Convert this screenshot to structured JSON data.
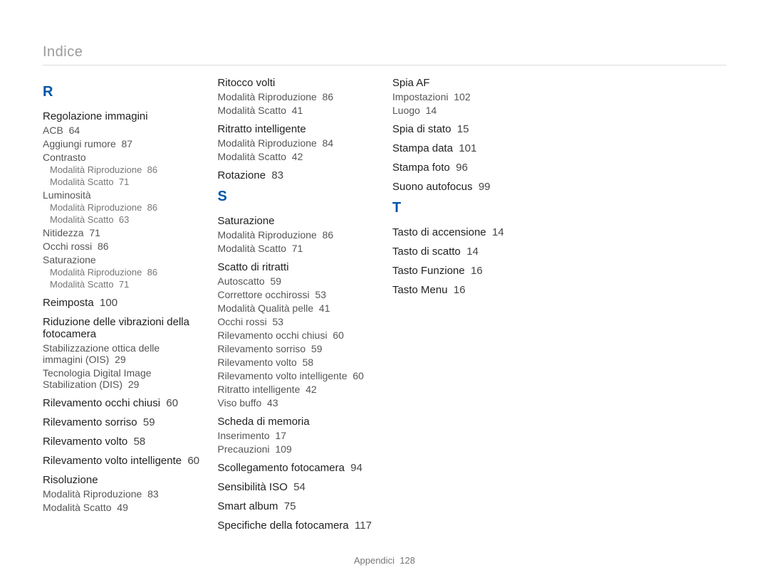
{
  "header": "Indice",
  "footer_label": "Appendici",
  "footer_page": "128",
  "sections": [
    {
      "letter": "R",
      "entries": [
        {
          "label": "Regolazione immagini",
          "subs": [
            {
              "label": "ACB",
              "page": "64"
            },
            {
              "label": "Aggiungi rumore",
              "page": "87"
            },
            {
              "label": "Contrasto",
              "subsubs": [
                {
                  "label": "Modalità Riproduzione",
                  "page": "86"
                },
                {
                  "label": "Modalità Scatto",
                  "page": "71"
                }
              ]
            },
            {
              "label": "Luminosità",
              "subsubs": [
                {
                  "label": "Modalità Riproduzione",
                  "page": "86"
                },
                {
                  "label": "Modalità Scatto",
                  "page": "63"
                }
              ]
            },
            {
              "label": "Nitidezza",
              "page": "71"
            },
            {
              "label": "Occhi rossi",
              "page": "86"
            },
            {
              "label": "Saturazione",
              "subsubs": [
                {
                  "label": "Modalità Riproduzione",
                  "page": "86"
                },
                {
                  "label": "Modalità Scatto",
                  "page": "71"
                }
              ]
            }
          ]
        },
        {
          "label": "Reimposta",
          "page": "100"
        },
        {
          "label": "Riduzione delle vibrazioni della fotocamera",
          "subs": [
            {
              "label": "Stabilizzazione ottica delle immagini (OIS)",
              "page": "29"
            },
            {
              "label": "Tecnologia Digital Image Stabilization (DIS)",
              "page": "29"
            }
          ]
        },
        {
          "label": "Rilevamento occhi chiusi",
          "page": "60"
        },
        {
          "label": "Rilevamento sorriso",
          "page": "59"
        },
        {
          "label": "Rilevamento volto",
          "page": "58"
        },
        {
          "label": "Rilevamento volto intelligente",
          "page": "60"
        },
        {
          "label": "Risoluzione",
          "subs": [
            {
              "label": "Modalità Riproduzione",
              "page": "83"
            },
            {
              "label": "Modalità Scatto",
              "page": "49"
            }
          ]
        },
        {
          "label": "Ritocco volti",
          "subs": [
            {
              "label": "Modalità Riproduzione",
              "page": "86"
            },
            {
              "label": "Modalità Scatto",
              "page": "41"
            }
          ]
        },
        {
          "label": "Ritratto intelligente",
          "subs": [
            {
              "label": "Modalità Riproduzione",
              "page": "84"
            },
            {
              "label": "Modalità Scatto",
              "page": "42"
            }
          ]
        },
        {
          "label": "Rotazione",
          "page": "83"
        }
      ]
    },
    {
      "letter": "S",
      "entries": [
        {
          "label": "Saturazione",
          "subs": [
            {
              "label": "Modalità Riproduzione",
              "page": "86"
            },
            {
              "label": "Modalità Scatto",
              "page": "71"
            }
          ]
        },
        {
          "label": "Scatto di ritratti",
          "subs": [
            {
              "label": "Autoscatto",
              "page": "59"
            },
            {
              "label": "Correttore occhirossi",
              "page": "53"
            },
            {
              "label": "Modalità Qualità pelle",
              "page": "41"
            },
            {
              "label": "Occhi rossi",
              "page": "53"
            },
            {
              "label": "Rilevamento occhi chiusi",
              "page": "60"
            },
            {
              "label": "Rilevamento sorriso",
              "page": "59"
            },
            {
              "label": "Rilevamento volto",
              "page": "58"
            },
            {
              "label": "Rilevamento volto intelligente",
              "page": "60"
            },
            {
              "label": "Ritratto intelligente",
              "page": "42"
            },
            {
              "label": "Viso buffo",
              "page": "43"
            }
          ]
        },
        {
          "label": "Scheda di memoria",
          "subs": [
            {
              "label": "Inserimento",
              "page": "17"
            },
            {
              "label": "Precauzioni",
              "page": "109"
            }
          ]
        },
        {
          "label": "Scollegamento fotocamera",
          "page": "94"
        },
        {
          "label": "Sensibilità ISO",
          "page": "54"
        },
        {
          "label": "Smart album",
          "page": "75"
        },
        {
          "label": "Specifiche della fotocamera",
          "page": "117"
        },
        {
          "label": "Spia AF",
          "subs": [
            {
              "label": "Impostazioni",
              "page": "102"
            },
            {
              "label": "Luogo",
              "page": "14"
            }
          ]
        },
        {
          "label": "Spia di stato",
          "page": "15"
        },
        {
          "label": "Stampa data",
          "page": "101"
        },
        {
          "label": "Stampa foto",
          "page": "96"
        },
        {
          "label": "Suono autofocus",
          "page": "99"
        }
      ]
    },
    {
      "letter": "T",
      "entries": [
        {
          "label": "Tasto di accensione",
          "page": "14"
        },
        {
          "label": "Tasto di scatto",
          "page": "14"
        },
        {
          "label": "Tasto Funzione",
          "page": "16"
        },
        {
          "label": "Tasto Menu",
          "page": "16"
        }
      ]
    }
  ]
}
